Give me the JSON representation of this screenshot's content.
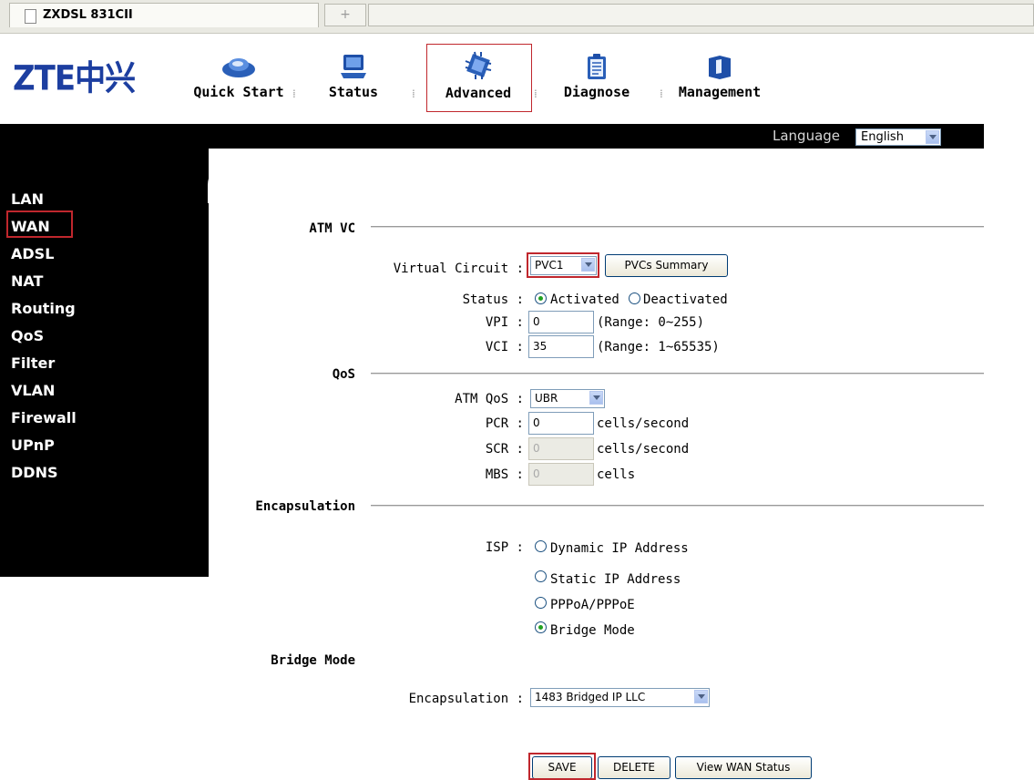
{
  "browser": {
    "tab_title": "ZXDSL 831CII",
    "new_tab": "+"
  },
  "header": {
    "logo": "ZTE中兴",
    "nav": [
      {
        "label": "Quick Start",
        "icon": "car-icon"
      },
      {
        "label": "Status",
        "icon": "laptop-icon"
      },
      {
        "label": "Advanced",
        "icon": "chip-icon",
        "selected": true
      },
      {
        "label": "Diagnose",
        "icon": "clipboard-icon"
      },
      {
        "label": "Management",
        "icon": "book-icon"
      }
    ],
    "separator": "⁞"
  },
  "language": {
    "label": "Language",
    "value": "English"
  },
  "sidebar": {
    "items": [
      "LAN",
      "WAN",
      "ADSL",
      "NAT",
      "Routing",
      "QoS",
      "Filter",
      "VLAN",
      "Firewall",
      "UPnP",
      "DDNS"
    ],
    "selected": "WAN"
  },
  "atm_vc": {
    "title": "ATM VC",
    "virtual_circuit_label": "Virtual Circuit :",
    "virtual_circuit_value": "PVC1",
    "pvcs_summary_button": "PVCs Summary",
    "status_label": "Status :",
    "status_options": [
      "Activated",
      "Deactivated"
    ],
    "status_selected": "Activated",
    "vpi_label": "VPI :",
    "vpi_value": "0",
    "vpi_range": "(Range: 0~255)",
    "vci_label": "VCI :",
    "vci_value": "35",
    "vci_range": "(Range: 1~65535)"
  },
  "qos": {
    "title": "QoS",
    "atm_qos_label": "ATM QoS :",
    "atm_qos_value": "UBR",
    "pcr_label": "PCR :",
    "pcr_value": "0",
    "pcr_unit": "cells/second",
    "scr_label": "SCR :",
    "scr_value": "0",
    "scr_unit": "cells/second",
    "mbs_label": "MBS :",
    "mbs_value": "0",
    "mbs_unit": "cells"
  },
  "encapsulation": {
    "title": "Encapsulation",
    "isp_label": "ISP :",
    "isp_options": [
      "Dynamic IP Address",
      "Static IP Address",
      "PPPoA/PPPoE",
      "Bridge Mode"
    ],
    "isp_selected": "Bridge Mode"
  },
  "bridge_mode": {
    "title": "Bridge Mode",
    "encap_label": "Encapsulation :",
    "encap_value": "1483 Bridged IP LLC"
  },
  "actions": {
    "save": "SAVE",
    "delete": "DELETE",
    "view_status": "View WAN Status"
  },
  "colors": {
    "highlight": "#c0272d",
    "logo": "#1c3ea0",
    "band": "#000000"
  }
}
